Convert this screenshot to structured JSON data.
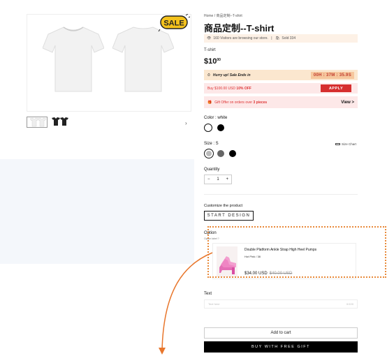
{
  "gallery": {
    "sale_badge": "SALE",
    "next_icon": "›"
  },
  "product": {
    "breadcrumb": "Home / 商品定制--T-shirt",
    "title": "商品定制--T-shirt",
    "visitors": "160 Visitors are browsing our store.",
    "sold": "Sold 334",
    "variant_title": "T-shirt",
    "price_main": "$10",
    "price_cents": "00",
    "hurry_label": "Hurry up! Sale Ends in",
    "timer": "00H : 37M : 35.9S",
    "promo_text": "Buy $100.00 USD",
    "promo_off": "10% OFF",
    "apply_label": "APPLY",
    "gift_text": "Gift Offer on orders over",
    "gift_qty": "3 pieces",
    "gift_view": "View >",
    "color_label": "Color : white",
    "size_label": "Size : S",
    "size_chart": "Size Chart",
    "quantity_label": "Quantity",
    "qty_minus": "−",
    "qty_value": "1",
    "qty_plus": "+",
    "customize_label": "Customize the product",
    "start_design": "START DESIGN",
    "option_label": "Option",
    "option_sub": "Option label ?",
    "option_product": {
      "name": "Double Platform Ankle Strap High Heel Pumps",
      "variant": "Hot Pink / 38",
      "price": "$34.00 USD",
      "old_price": "$40.00 USD"
    },
    "text_label": "Text",
    "text_placeholder": "Text here",
    "text_counter": "0/100",
    "add_to_cart": "Add to cart",
    "buy_gift": "BUY WITH FREE GIFT"
  },
  "colors": {
    "accent_red": "#d62f2f",
    "callout_orange": "#e8762c",
    "highlight_peach": "#fbe7cf",
    "promo_pink": "#fde8e8"
  }
}
